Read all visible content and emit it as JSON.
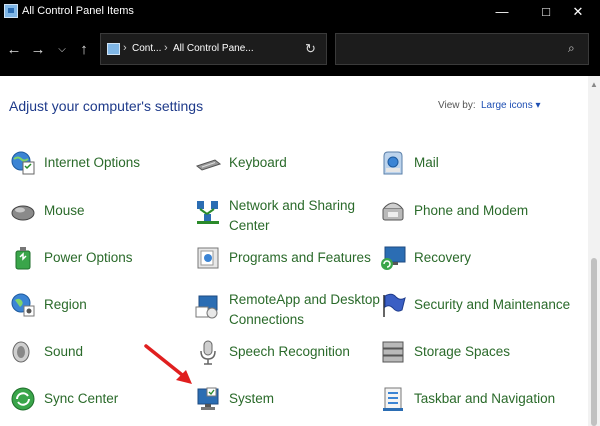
{
  "window": {
    "title": "All Control Panel Items"
  },
  "address": {
    "crumbs": [
      "Cont...",
      "All Control Pane..."
    ],
    "separator": "›"
  },
  "search": {
    "placeholder": ""
  },
  "header": {
    "title": "Adjust your computer's settings",
    "view_by_label": "View by:",
    "view_by_value": "Large icons ▾"
  },
  "items": [
    [
      "Internet Options",
      "Keyboard",
      "Mail"
    ],
    [
      "Mouse",
      "Network and Sharing Center",
      "Phone and Modem"
    ],
    [
      "Power Options",
      "Programs and Features",
      "Recovery"
    ],
    [
      "Region",
      "RemoteApp and Desktop Connections",
      "Security and Maintenance"
    ],
    [
      "Sound",
      "Speech Recognition",
      "Storage Spaces"
    ],
    [
      "Sync Center",
      "System",
      "Taskbar and Navigation"
    ]
  ],
  "items_split": {
    "network_line1": "Network and Sharing",
    "network_line2": "Center",
    "remote_line1": "RemoteApp and Desktop",
    "remote_line2": "Connections"
  },
  "colors": {
    "title_bar": "#000000",
    "link_green": "#2a6a2a",
    "heading_blue": "#1e3a8a",
    "annotation_arrow": "#e01f1f"
  }
}
